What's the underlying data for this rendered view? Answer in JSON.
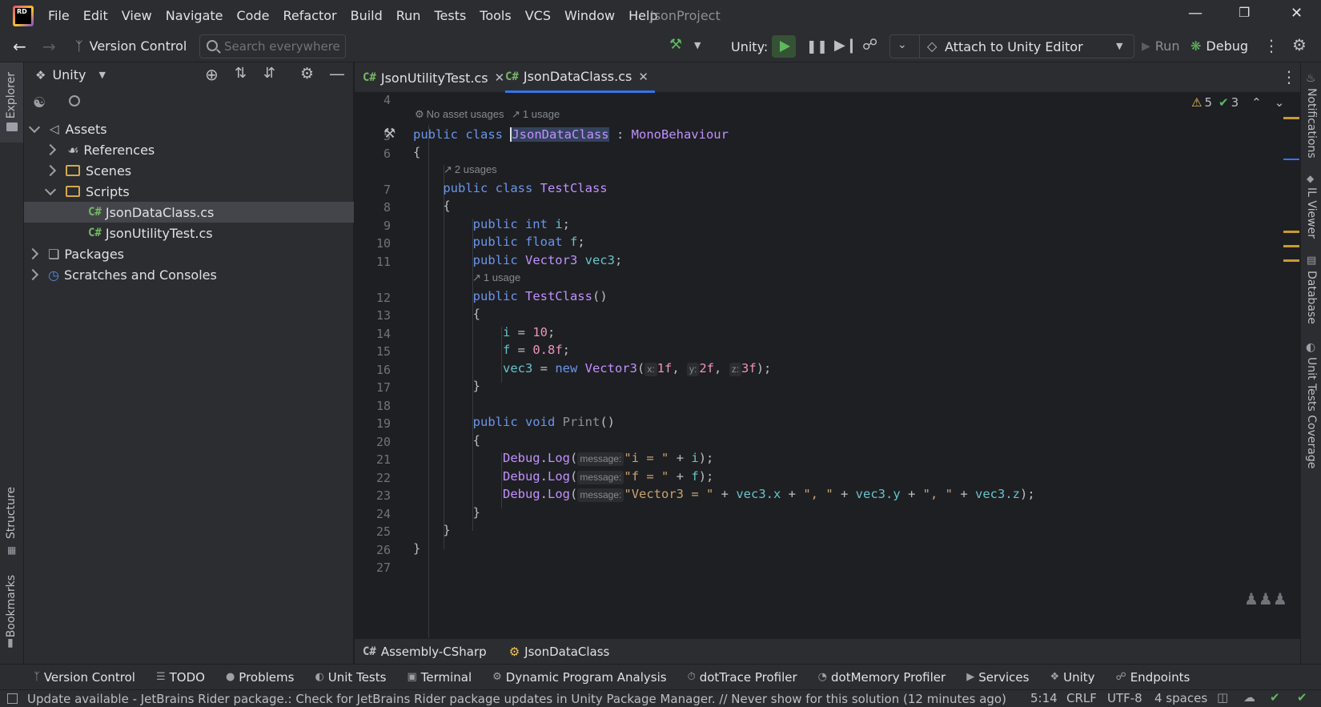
{
  "app": {
    "title": "JsonProject",
    "logo": "RD"
  },
  "menu": [
    "File",
    "Edit",
    "View",
    "Navigate",
    "Code",
    "Refactor",
    "Build",
    "Run",
    "Tests",
    "Tools",
    "VCS",
    "Window",
    "Help"
  ],
  "toolbar": {
    "vcs_label": "Version Control",
    "search_placeholder": "Search everywhere",
    "unity_label": "Unity:",
    "attach_label": "Attach to Unity Editor",
    "run_label": "Run",
    "debug_label": "Debug"
  },
  "left_strip": {
    "top": "Explorer",
    "middle": "Structure",
    "bottom": "Bookmarks"
  },
  "explorer": {
    "header": "Unity",
    "tree": [
      {
        "label": "Assets",
        "depth": 0,
        "state": "open",
        "icon": "unity-assets-icon"
      },
      {
        "label": "References",
        "depth": 1,
        "state": "closed",
        "icon": "references-icon"
      },
      {
        "label": "Scenes",
        "depth": 1,
        "state": "closed",
        "icon": "folder-icon"
      },
      {
        "label": "Scripts",
        "depth": 1,
        "state": "open",
        "icon": "folder-icon"
      },
      {
        "label": "JsonDataClass.cs",
        "depth": 2,
        "state": "leaf",
        "icon": "csharp-file-icon",
        "selected": true
      },
      {
        "label": "JsonUtilityTest.cs",
        "depth": 2,
        "state": "leaf",
        "icon": "csharp-file-icon"
      },
      {
        "label": "Packages",
        "depth": 0,
        "state": "closed",
        "icon": "packages-icon"
      },
      {
        "label": "Scratches and Consoles",
        "depth": 0,
        "state": "closed",
        "icon": "scratches-icon"
      }
    ]
  },
  "tabs": [
    {
      "prefix": "C#",
      "label": "JsonUtilityTest.cs",
      "active": false
    },
    {
      "prefix": "C#",
      "label": "JsonDataClass.cs",
      "active": true
    }
  ],
  "inspections": {
    "warnings": "5",
    "ok": "3"
  },
  "code": {
    "hint_no_asset": "No asset usages",
    "hint_1_usage": "1 usage",
    "hint_2_usages": "2 usages",
    "hint_ctor_usage": "1 usage",
    "lines": [
      "4",
      "5",
      "6",
      "7",
      "8",
      "9",
      "10",
      "11",
      "12",
      "13",
      "14",
      "15",
      "16",
      "17",
      "18",
      "19",
      "20",
      "21",
      "22",
      "23",
      "24",
      "25",
      "26",
      "27"
    ]
  },
  "right_strip": [
    "Notifications",
    "IL Viewer",
    "Database",
    "Unit Tests Coverage"
  ],
  "navbar": {
    "project": "Assembly-CSharp",
    "class": "JsonDataClass"
  },
  "tool_windows": [
    "Version Control",
    "TODO",
    "Problems",
    "Unit Tests",
    "Terminal",
    "Dynamic Program Analysis",
    "dotTrace Profiler",
    "dotMemory Profiler",
    "Services",
    "Unity",
    "Endpoints"
  ],
  "status": {
    "message": "Update available - JetBrains Rider package.: Check for JetBrains Rider package updates in Unity Package Manager. // Never show for this solution (12 minutes ago)",
    "position": "5:14",
    "line_sep": "CRLF",
    "encoding": "UTF-8",
    "indent": "4 spaces"
  }
}
